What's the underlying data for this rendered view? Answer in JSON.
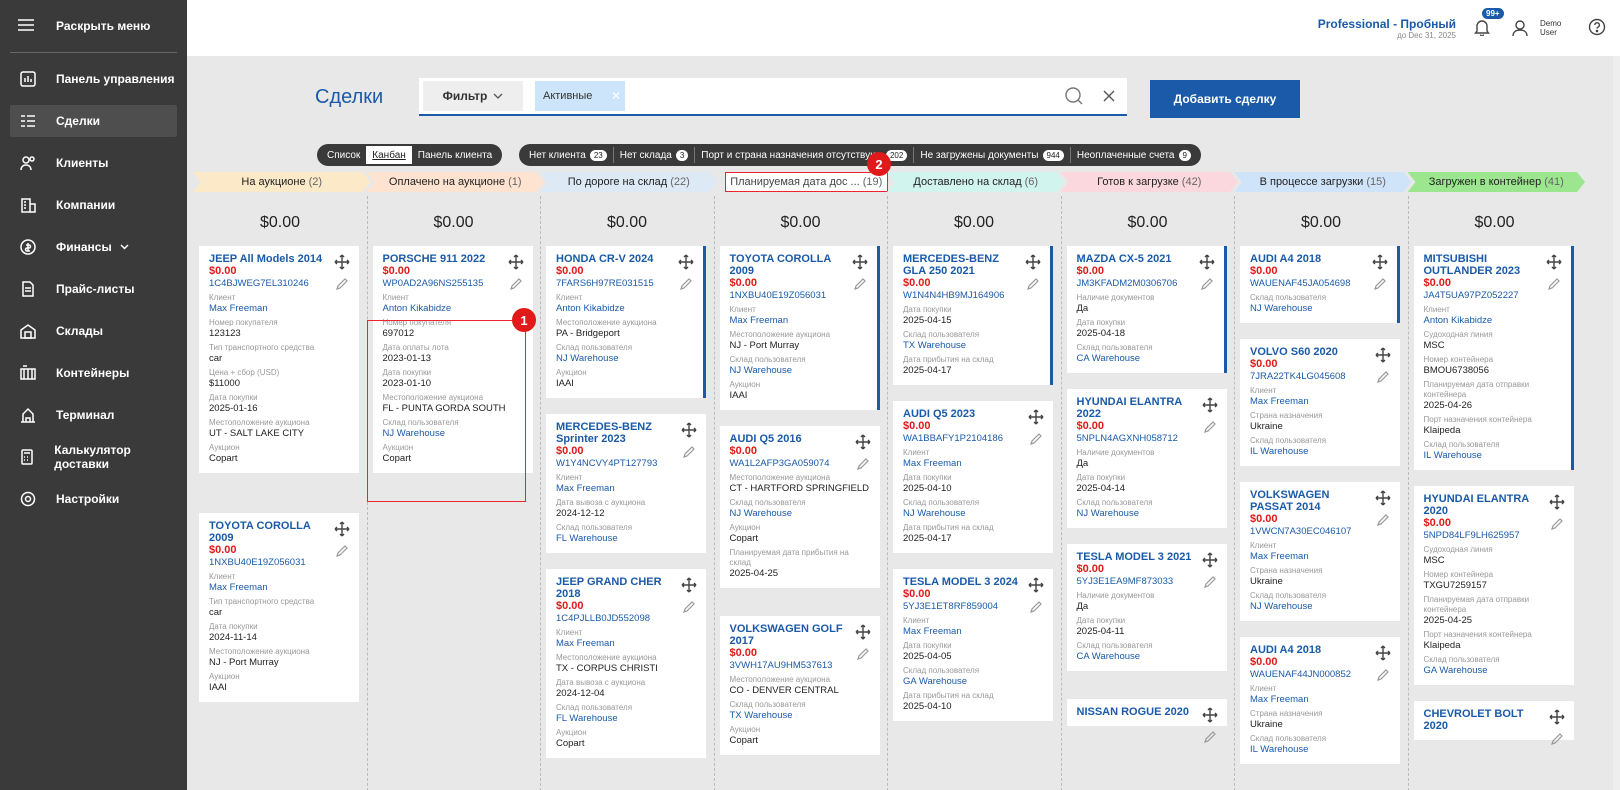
{
  "sidebar": {
    "toggle_label": "Раскрыть меню",
    "items": [
      {
        "label": "Панель управления",
        "icon": "dashboard-icon"
      },
      {
        "label": "Сделки",
        "icon": "deals-icon"
      },
      {
        "label": "Клиенты",
        "icon": "clients-icon"
      },
      {
        "label": "Компании",
        "icon": "companies-icon"
      },
      {
        "label": "Финансы",
        "icon": "finance-icon"
      },
      {
        "label": "Прайс-листы",
        "icon": "pricelist-icon"
      },
      {
        "label": "Склады",
        "icon": "warehouse-icon"
      },
      {
        "label": "Контейнеры",
        "icon": "container-icon"
      },
      {
        "label": "Терминал",
        "icon": "terminal-icon"
      },
      {
        "label": "Калькулятор доставки",
        "icon": "calculator-icon"
      },
      {
        "label": "Настройки",
        "icon": "settings-icon"
      }
    ]
  },
  "topbar": {
    "plan_title": "Professional - Пробный",
    "plan_sub": "до Dec 31, 2025",
    "notif_badge": "99+",
    "user_name": "Demo User"
  },
  "main": {
    "title": "Сделки",
    "filter_label": "Фильтр",
    "chip_label": "Активные",
    "add_button": "Добавить сделку"
  },
  "views": [
    "Список",
    "Канбан",
    "Панель клиента"
  ],
  "quick_filters": [
    {
      "label": "Нет клиента",
      "count": "23"
    },
    {
      "label": "Нет склада",
      "count": "3"
    },
    {
      "label": "Порт и страна назначения отсутствуют",
      "count": "202"
    },
    {
      "label": "Не загружены документы",
      "count": "944"
    },
    {
      "label": "Неоплаченные счета",
      "count": "9"
    }
  ],
  "stages": [
    {
      "label": "На аукционе",
      "count": "(2)",
      "color": "#fbe9c8"
    },
    {
      "label": "Оплачено на аукционе",
      "count": "(1)",
      "color": "#fde3d0"
    },
    {
      "label": "По дороге на склад",
      "count": "(22)",
      "color": "#dde9f5"
    },
    {
      "label": "Планируемая дата дос ...",
      "count": "(19)",
      "color": "#ffffff"
    },
    {
      "label": "Доставлено на склад",
      "count": "(6)",
      "color": "#d2f4ef"
    },
    {
      "label": "Готов к загрузке",
      "count": "(42)",
      "color": "#fbd7de"
    },
    {
      "label": "В процессе загрузки",
      "count": "(15)",
      "color": "#cfe4f9"
    },
    {
      "label": "Загружен в контейнер",
      "count": "(41)",
      "color": "#9be68f"
    }
  ],
  "columns": [
    {
      "sum": "$0.00",
      "cards": [
        {
          "title": "JEEP All Models 2014",
          "price": "$0.00",
          "vin": "1C4BJWEG7EL310246",
          "fields": [
            [
              "Клиент",
              "Max Freeman",
              "link"
            ],
            [
              "Номер покупателя",
              "123123",
              ""
            ],
            [
              "Тип транспортного средства",
              "car",
              ""
            ],
            [
              "Цена + сбор (USD)",
              "$11000",
              ""
            ],
            [
              "Дата покупки",
              "2025-01-16",
              ""
            ],
            [
              "Местоположение аукциона",
              "UT - SALT LAKE CITY",
              ""
            ],
            [
              "Аукцион",
              "Copart",
              ""
            ]
          ]
        },
        {
          "title": "TOYOTA COROLLA 2009",
          "price": "$0.00",
          "vin": "1NXBU40E19Z056031",
          "fields": [
            [
              "Клиент",
              "Max Freeman",
              "link"
            ],
            [
              "Тип транспортного средства",
              "car",
              ""
            ],
            [
              "Дата покупки",
              "2024-11-14",
              ""
            ],
            [
              "Местоположение аукциона",
              "NJ - Port Murray",
              ""
            ],
            [
              "Аукцион",
              "IAAI",
              ""
            ]
          ]
        }
      ]
    },
    {
      "sum": "$0.00",
      "cards": [
        {
          "title": "PORSCHE 911 2022",
          "price": "$0.00",
          "vin": "WP0AD2A96NS255135",
          "fields": [
            [
              "Клиент",
              "Anton Kikabidze",
              "link"
            ],
            [
              "Номер покупателя",
              "697012",
              ""
            ],
            [
              "Дата оплаты лота",
              "2023-01-13",
              ""
            ],
            [
              "Дата покупки",
              "2023-01-10",
              ""
            ],
            [
              "Местоположение аукциона",
              "FL - PUNTA GORDA SOUTH",
              ""
            ],
            [
              "Склад пользователя",
              "NJ Warehouse",
              "link"
            ],
            [
              "Аукцион",
              "Copart",
              ""
            ]
          ]
        }
      ]
    },
    {
      "sum": "$0.00",
      "cards": [
        {
          "title": "HONDA CR-V 2024",
          "price": "$0.00",
          "vin": "7FARS6H97RE031515",
          "fields": [
            [
              "Клиент",
              "Anton Kikabidze",
              "link"
            ],
            [
              "Местоположение аукциона",
              "PA - Bridgeport",
              ""
            ],
            [
              "Склад пользователя",
              "NJ Warehouse",
              "link"
            ],
            [
              "Аукцион",
              "IAAI",
              ""
            ]
          ]
        },
        {
          "title": "MERCEDES-BENZ Sprinter 2023",
          "price": "$0.00",
          "vin": "W1Y4NCVY4PT127793",
          "fields": [
            [
              "Клиент",
              "Max Freeman",
              "link"
            ],
            [
              "Дата вывоза с аукциона",
              "2024-12-12",
              ""
            ],
            [
              "Склад пользователя",
              "FL Warehouse",
              "link"
            ]
          ]
        },
        {
          "title": "JEEP GRAND CHER 2018",
          "price": "$0.00",
          "vin": "1C4PJLLB0JD552098",
          "fields": [
            [
              "Клиент",
              "Max Freeman",
              "link"
            ],
            [
              "Местоположение аукциона",
              "TX - CORPUS CHRISTI",
              ""
            ],
            [
              "Дата вывоза с аукциона",
              "2024-12-04",
              ""
            ],
            [
              "Склад пользователя",
              "FL Warehouse",
              "link"
            ],
            [
              "Аукцион",
              "Copart",
              ""
            ]
          ]
        }
      ]
    },
    {
      "sum": "$0.00",
      "cards": [
        {
          "title": "TOYOTA COROLLA 2009",
          "price": "$0.00",
          "vin": "1NXBU40E19Z056031",
          "fields": [
            [
              "Клиент",
              "Max Freeman",
              "link"
            ],
            [
              "Местоположение аукциона",
              "NJ - Port Murray",
              ""
            ],
            [
              "Склад пользователя",
              "NJ Warehouse",
              "link"
            ],
            [
              "Аукцион",
              "IAAI",
              ""
            ]
          ]
        },
        {
          "title": "AUDI Q5 2016",
          "price": "$0.00",
          "vin": "WA1L2AFP3GA059074",
          "fields": [
            [
              "Местоположение аукциона",
              "CT - HARTFORD SPRINGFIELD",
              ""
            ],
            [
              "Склад пользователя",
              "NJ Warehouse",
              "link"
            ],
            [
              "Аукцион",
              "Copart",
              ""
            ],
            [
              "Планируемая дата прибытия на склад",
              "2025-04-25",
              ""
            ]
          ]
        },
        {
          "title": "VOLKSWAGEN GOLF 2017",
          "price": "$0.00",
          "vin": "3VWH17AU9HM537613",
          "fields": [
            [
              "Местоположение аукциона",
              "CO - DENVER CENTRAL",
              ""
            ],
            [
              "Склад пользователя",
              "TX Warehouse",
              "link"
            ],
            [
              "Аукцион",
              "Copart",
              ""
            ]
          ]
        }
      ]
    },
    {
      "sum": "$0.00",
      "cards": [
        {
          "title": "MERCEDES-BENZ GLA 250 2021",
          "price": "$0.00",
          "vin": "W1N4N4HB9MJ164906",
          "fields": [
            [
              "Дата покупки",
              "2025-04-15",
              ""
            ],
            [
              "Склад пользователя",
              "TX Warehouse",
              "link"
            ],
            [
              "Дата прибытия на склад",
              "2025-04-17",
              ""
            ]
          ]
        },
        {
          "title": "AUDI Q5 2023",
          "price": "$0.00",
          "vin": "WA1BBAFY1P2104186",
          "fields": [
            [
              "Клиент",
              "Max Freeman",
              "link"
            ],
            [
              "Дата покупки",
              "2025-04-10",
              ""
            ],
            [
              "Склад пользователя",
              "NJ Warehouse",
              "link"
            ],
            [
              "Дата прибытия на склад",
              "2025-04-17",
              ""
            ]
          ]
        },
        {
          "title": "TESLA MODEL 3 2024",
          "price": "$0.00",
          "vin": "5YJ3E1ET8RF859004",
          "fields": [
            [
              "Клиент",
              "Max Freeman",
              "link"
            ],
            [
              "Дата покупки",
              "2025-04-05",
              ""
            ],
            [
              "Склад пользователя",
              "GA Warehouse",
              "link"
            ],
            [
              "Дата прибытия на склад",
              "2025-04-10",
              ""
            ]
          ]
        }
      ]
    },
    {
      "sum": "$0.00",
      "cards": [
        {
          "title": "MAZDA CX-5 2021",
          "price": "$0.00",
          "vin": "JM3KFADM2M0306706",
          "fields": [
            [
              "Наличие документов",
              "Да",
              ""
            ],
            [
              "Дата покупки",
              "2025-04-18",
              ""
            ],
            [
              "Склад пользователя",
              "CA Warehouse",
              "link"
            ]
          ]
        },
        {
          "title": "HYUNDAI ELANTRA 2022",
          "price": "$0.00",
          "vin": "5NPLN4AGXNH058712",
          "fields": [
            [
              "Наличие документов",
              "Да",
              ""
            ],
            [
              "Дата покупки",
              "2025-04-14",
              ""
            ],
            [
              "Склад пользователя",
              "NJ Warehouse",
              "link"
            ]
          ]
        },
        {
          "title": "TESLA MODEL 3 2021",
          "price": "$0.00",
          "vin": "5YJ3E1EA9MF873033",
          "fields": [
            [
              "Наличие документов",
              "Да",
              ""
            ],
            [
              "Дата покупки",
              "2025-04-11",
              ""
            ],
            [
              "Склад пользователя",
              "CA Warehouse",
              "link"
            ]
          ]
        },
        {
          "title": "NISSAN ROGUE 2020",
          "price": "",
          "vin": "",
          "fields": []
        }
      ]
    },
    {
      "sum": "$0.00",
      "cards": [
        {
          "title": "AUDI A4 2018",
          "price": "$0.00",
          "vin": "WAUENAF45JA054698",
          "fields": [
            [
              "Склад пользователя",
              "NJ Warehouse",
              "link"
            ]
          ]
        },
        {
          "title": "VOLVO S60 2020",
          "price": "$0.00",
          "vin": "7JRA22TK4LG045608",
          "fields": [
            [
              "Клиент",
              "Max Freeman",
              "link"
            ],
            [
              "Страна назначения",
              "Ukraine",
              ""
            ],
            [
              "Склад пользователя",
              "IL Warehouse",
              "link"
            ]
          ]
        },
        {
          "title": "VOLKSWAGEN PASSAT 2014",
          "price": "$0.00",
          "vin": "1VWCN7A30EC046107",
          "fields": [
            [
              "Клиент",
              "Max Freeman",
              "link"
            ],
            [
              "Страна назначения",
              "Ukraine",
              ""
            ],
            [
              "Склад пользователя",
              "NJ Warehouse",
              "link"
            ]
          ]
        },
        {
          "title": "AUDI A4 2018",
          "price": "$0.00",
          "vin": "WAUENAF44JN000852",
          "fields": [
            [
              "Клиент",
              "Max Freeman",
              "link"
            ],
            [
              "Страна назначения",
              "Ukraine",
              ""
            ],
            [
              "Склад пользователя",
              "IL Warehouse",
              "link"
            ]
          ]
        }
      ]
    },
    {
      "sum": "$0.00",
      "cards": [
        {
          "title": "MITSUBISHI OUTLANDER 2023",
          "price": "$0.00",
          "vin": "JA4T5UA97PZ052227",
          "fields": [
            [
              "Клиент",
              "Anton Kikabidze",
              "link"
            ],
            [
              "Судоходная линия",
              "MSC",
              ""
            ],
            [
              "Номер контейнера",
              "BMOU6738056",
              ""
            ],
            [
              "Планируемая дата отправки контейнера",
              "2025-04-26",
              ""
            ],
            [
              "Порт назначения контейнера",
              "Klaipeda",
              ""
            ],
            [
              "Склад пользователя",
              "IL Warehouse",
              "link"
            ]
          ]
        },
        {
          "title": "HYUNDAI ELANTRA 2020",
          "price": "$0.00",
          "vin": "5NPD84LF9LH625957",
          "fields": [
            [
              "Судоходная линия",
              "MSC",
              ""
            ],
            [
              "Номер контейнера",
              "TXGU7259157",
              ""
            ],
            [
              "Планируемая дата отправки контейнера",
              "2025-04-25",
              ""
            ],
            [
              "Порт назначения контейнера",
              "Klaipeda",
              ""
            ],
            [
              "Склад пользователя",
              "GA Warehouse",
              "link"
            ]
          ]
        },
        {
          "title": "CHEVROLET BOLT 2020",
          "price": "",
          "vin": "",
          "fields": []
        }
      ]
    }
  ],
  "markers": [
    "1",
    "2"
  ]
}
